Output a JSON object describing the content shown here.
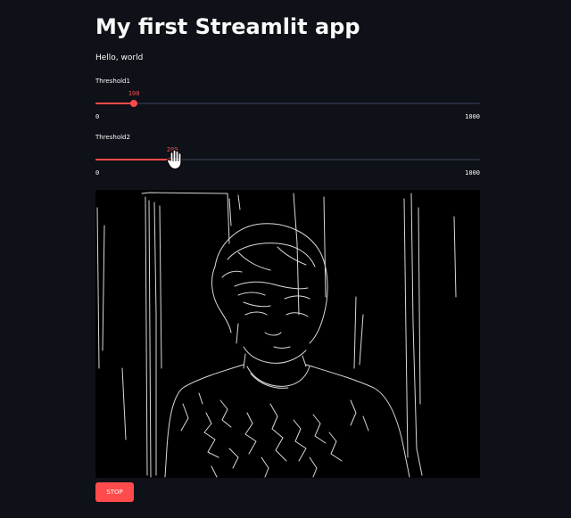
{
  "app": {
    "title": "My first Streamlit app",
    "greeting": "Hello, world"
  },
  "sliders": [
    {
      "label": "Threshold1",
      "value": 100,
      "value_text": "100",
      "min": 0,
      "max": 1000,
      "min_text": "0",
      "max_text": "1000"
    },
    {
      "label": "Threshold2",
      "value": 200,
      "value_text": "200",
      "min": 0,
      "max": 1000,
      "min_text": "0",
      "max_text": "1000"
    }
  ],
  "video": {
    "description_icon": "edge-detected-webcam-frame"
  },
  "stop_button": {
    "label": "STOP"
  },
  "colors": {
    "background": "#0e1117",
    "accent": "#ff4b4b",
    "track": "#262a3a",
    "text": "#fafafa"
  },
  "cursor_icon": "grab-hand-icon"
}
